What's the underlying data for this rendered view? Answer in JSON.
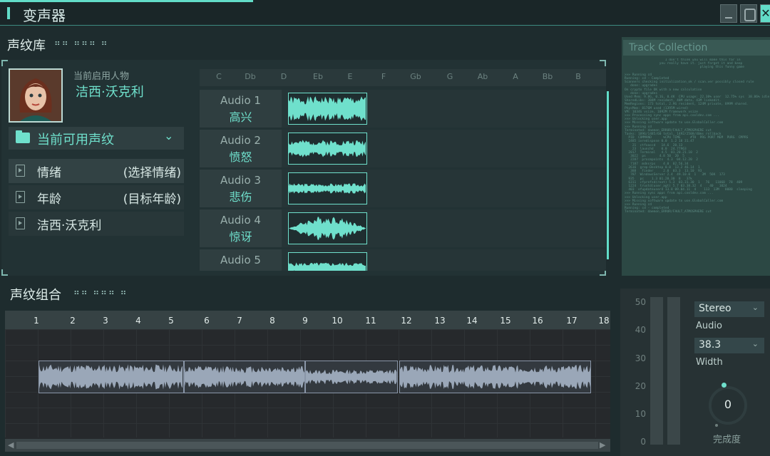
{
  "app": {
    "title": "变声器"
  },
  "library": {
    "section_title": "声纹库",
    "section_dots": "⠶⠶ ⠶⠶⠶ ⠶",
    "character_caption": "当前启用人物",
    "character_name": "洁西·沃克利",
    "dropdown_label": "当前可用声纹",
    "filters": [
      {
        "name": "情绪",
        "hint": "(选择情绪)"
      },
      {
        "name": "年龄",
        "hint": "(目标年龄)"
      },
      {
        "name": "洁西·沃克利",
        "hint": ""
      }
    ],
    "keys": [
      "C",
      "Db",
      "D",
      "Eb",
      "E",
      "F",
      "Gb",
      "G",
      "Ab",
      "A",
      "Bb",
      "B"
    ],
    "tracks": [
      {
        "name": "Audio 1",
        "emotion": "高兴"
      },
      {
        "name": "Audio 2",
        "emotion": "愤怒"
      },
      {
        "name": "Audio 3",
        "emotion": "悲伤"
      },
      {
        "name": "Audio 4",
        "emotion": "惊讶"
      },
      {
        "name": "Audio 5",
        "emotion": ""
      }
    ]
  },
  "terminal": {
    "title": "Track Collection",
    "lines": "                     I don't think you will make this far in\n                  you really have it. just forget it and keep\n                                       playing this funny game\n\n>>> Running cd\nRunning: cd - Completed\nScanners checking initialization_ok / scan.ver possibly closed rule\n   done: upgrades\nOn crypto file OK with a new calculation\n   done: upgrades\nUsed Mem: 9.8G, 0.1G, 0.4K  CPU usage: 22.38% user  12.75% sys  38.86% idle\nSharedLibs: 384M resident, 48M data, 43M linkedit.\nMemRegions: 173 total, 2.9G resident, 124M private, 899M shared.\nPhysMem: 8176M used (1395M wired)\nVM: 1034G vsize, 1092M framework vsize\n>>> Processing sync apps from api.cooldev.com ...\n>>> Unlocking user.app\n>>> Missing software update to use.GlobalCaller.com\n>>> Running cd\nTerminated: daemon_ERROR/FAULT_ATMOSPHERE cut\nTasks: 1896/1485/60 total, 1492/2508/40ms rollback\n  PID  COMMAND      %CPU TIME     #TH  PRG PORT MEM  PURG  CMPRS\n  2485 ioredispose 0.0  1.2 18 31.47\n    21  ctfxaccd   14.6  20.13\n    23  launchd    0.0  24.77963\n  2817  Terminal   4.5  01.20.21.10  2\n   3022  ps       4.8 50  20  5\n   2287  procmpoints  4.3  04.12.20  2\n   7187  mdnsrps    4.0  02.56.34\n  2616  grep-Desktop 0.0  13.2 46.14  1\n   388   Finder     2.0  03.3  13.10  93\n   787  WindowsServer 2.4  49.10.0  1   3M  56K  173\n  935   pc    1.3 01.28.30  8   37k\n  6311  cfprefsd(root) 5.3  03.31.30  1   76   11068  78  409\n  1224  trustd(user_agt) 5.7 03.38.32  4    40   1024\n  403  ofupdateuserd 13.8 09.04.11  4    113  13M   8080  sleeping\n>>> Running sync apps from api.cooldev.com ...\n>>> Unlocking user.app\n>>> Missing software update to use.GlobalCaller.com\n>>> Running cd\nRunning: cd - completed\nTerminated: daemon_ERROR/FAULT_ATMOSPHERE cut"
  },
  "combination": {
    "section_title": "声纹组合",
    "section_dots": "⠶⠶ ⠶⠶⠶ ⠶",
    "ruler": [
      "1",
      "2",
      "3",
      "4",
      "5",
      "6",
      "7",
      "8",
      "9",
      "10",
      "11",
      "12",
      "13",
      "14",
      "15",
      "16",
      "17",
      "18"
    ]
  },
  "mixer": {
    "scale": [
      "50",
      "40",
      "30",
      "20",
      "10",
      "0"
    ],
    "channel_value": "Stereo",
    "channel_label": "Audio",
    "width_value": "38.3",
    "width_label": "Width",
    "knob_value": "0",
    "knob_label": "完成度"
  },
  "colors": {
    "accent": "#62dcc8",
    "bg": "#1e2c2e",
    "panel": "#223234"
  }
}
